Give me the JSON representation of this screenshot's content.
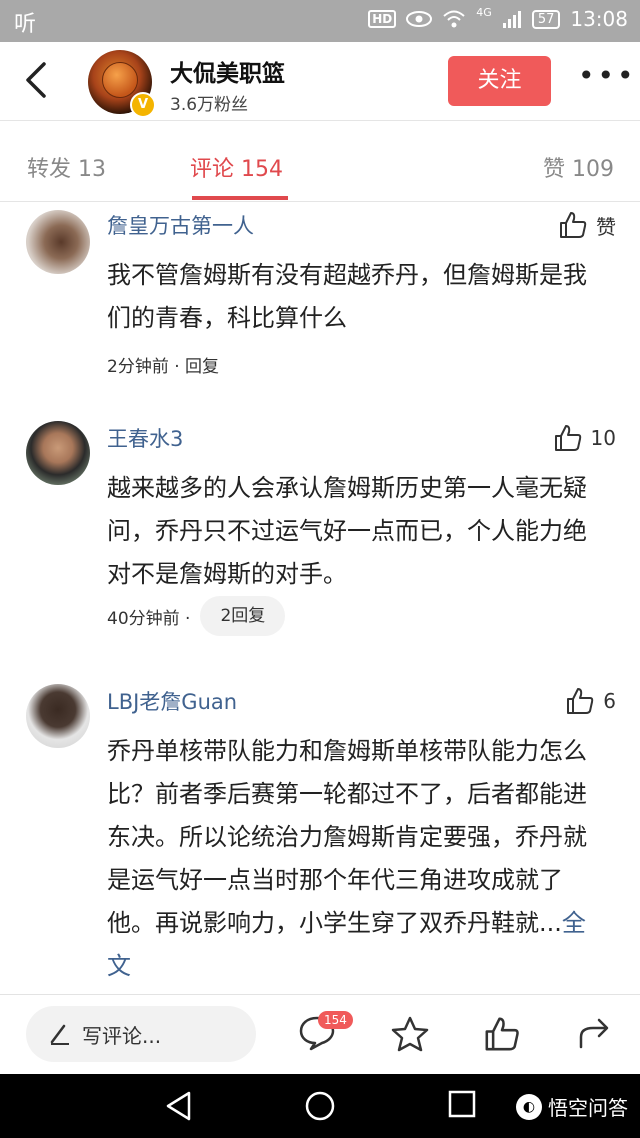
{
  "status_bar": {
    "left_icon": "听",
    "hd": "HD",
    "signal_label": "4G",
    "battery": "57",
    "time": "13:08"
  },
  "header": {
    "account_name": "大侃美职篮",
    "fans": "3.6万粉丝",
    "follow_label": "关注",
    "verified_mark": "V"
  },
  "tabs": [
    {
      "label": "转发 13"
    },
    {
      "label": "评论 154"
    },
    {
      "label": "赞 109"
    }
  ],
  "comments": [
    {
      "user": "詹皇万古第一人",
      "likes": "赞",
      "text": "我不管詹姆斯有没有超越乔丹，但詹姆斯是我们的青春，科比算什么",
      "time": "2分钟前 · 回复",
      "reply": ""
    },
    {
      "user": "王春水3",
      "likes": "10",
      "text": "越来越多的人会承认詹姆斯历史第一人毫无疑问，乔丹只不过运气好一点而已，个人能力绝对不是詹姆斯的对手。",
      "time": "40分钟前 ·",
      "reply": "2回复"
    },
    {
      "user": "LBJ老詹Guan",
      "likes": "6",
      "text": "乔丹单核带队能力和詹姆斯单核带队能力怎么比？前者季后赛第一轮都过不了，后者都能进东决。所以论统治力詹姆斯肯定要强，乔丹就是运气好一点当时那个年代三角进攻成就了他。再说影响力，小学生穿了双乔丹鞋就...",
      "more": "全文",
      "time": "",
      "reply": ""
    }
  ],
  "bottom_bar": {
    "write_placeholder": "写评论...",
    "comment_count": "154"
  },
  "watermark": "悟空问答",
  "colors": {
    "accent": "#e0494d",
    "follow_bg": "#f05a5a",
    "username": "#40628f",
    "status_bar": "#a9a9a9"
  }
}
